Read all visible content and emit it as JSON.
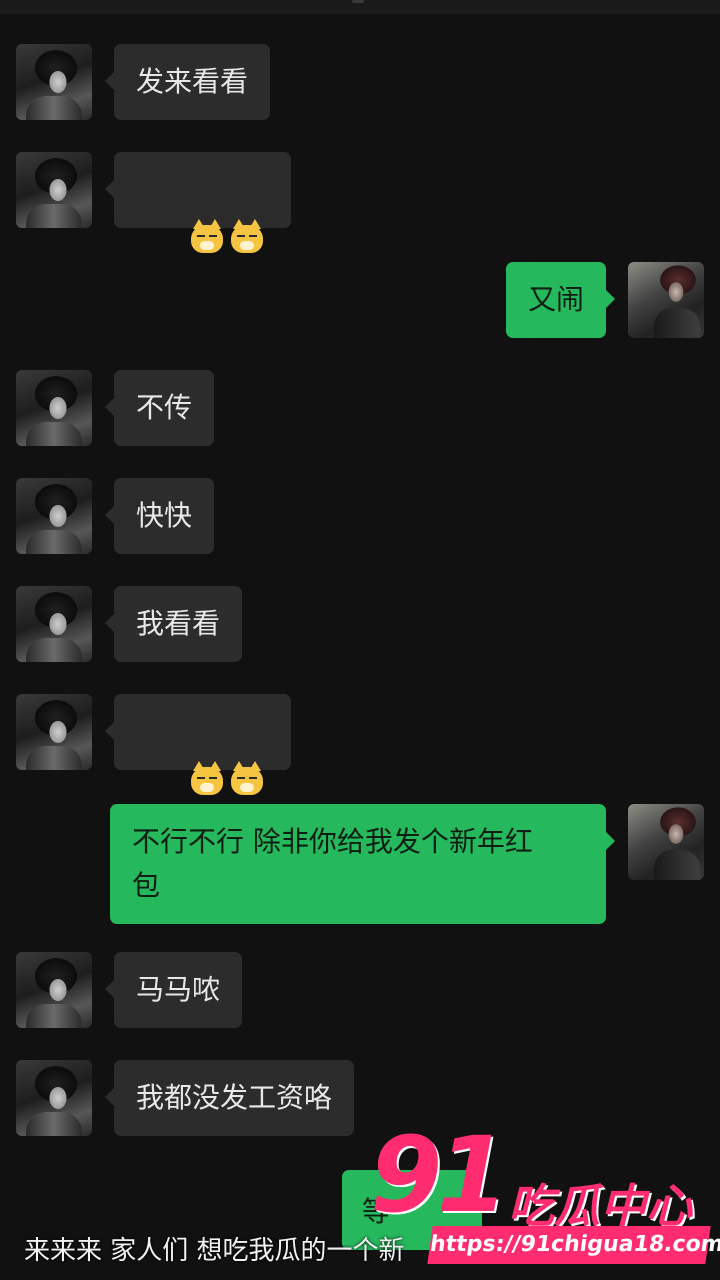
{
  "messages": [
    {
      "side": "in",
      "text": "发来看看"
    },
    {
      "side": "in",
      "emoji": "cat-face-icon x2"
    },
    {
      "side": "out",
      "text": "又闹"
    },
    {
      "side": "in",
      "text": "不传"
    },
    {
      "side": "in",
      "text": "快快"
    },
    {
      "side": "in",
      "text": "我看看"
    },
    {
      "side": "in",
      "emoji": "cat-face-icon x2"
    },
    {
      "side": "out",
      "text": "不行不行 除非你给我发个新年红\n包"
    },
    {
      "side": "in",
      "text": "马马哝"
    },
    {
      "side": "in",
      "text": "我都没发工资咯"
    },
    {
      "side": "out",
      "text": "等"
    }
  ],
  "caption": "来来来 家人们 想吃我瓜的一个新",
  "watermark": {
    "number": "91",
    "name": "吃瓜中心",
    "url": "https://91chigua18.com"
  },
  "colors": {
    "background": "#111111",
    "incoming_bubble": "#2c2c2c",
    "outgoing_bubble": "#26b85d",
    "watermark": "#ff2d6f"
  }
}
